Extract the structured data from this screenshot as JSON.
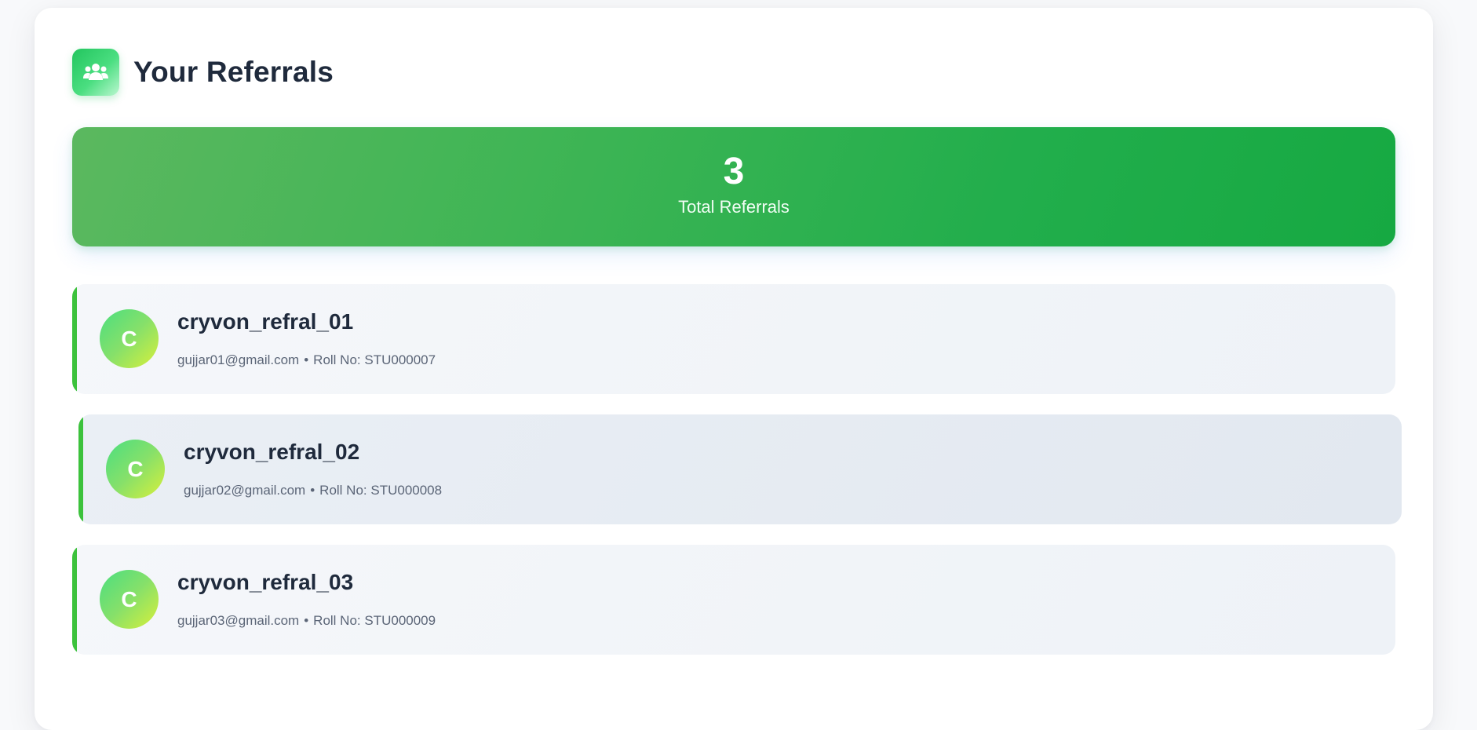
{
  "header": {
    "title": "Your Referrals",
    "icon": "users-icon"
  },
  "summary": {
    "total_value": "3",
    "total_label": "Total Referrals"
  },
  "referrals": [
    {
      "avatar_letter": "C",
      "name": "cryvon_refral_01",
      "email": "gujjar01@gmail.com",
      "separator": "•",
      "roll": "Roll No: STU000007"
    },
    {
      "avatar_letter": "C",
      "name": "cryvon_refral_02",
      "email": "gujjar02@gmail.com",
      "separator": "•",
      "roll": "Roll No: STU000008"
    },
    {
      "avatar_letter": "C",
      "name": "cryvon_refral_03",
      "email": "gujjar03@gmail.com",
      "separator": "•",
      "roll": "Roll No: STU000009"
    }
  ],
  "colors": {
    "accent_green": "#16a942",
    "title_text": "#1f2a3c",
    "meta_text": "#5b6577",
    "border_green": "#3cc23c"
  }
}
